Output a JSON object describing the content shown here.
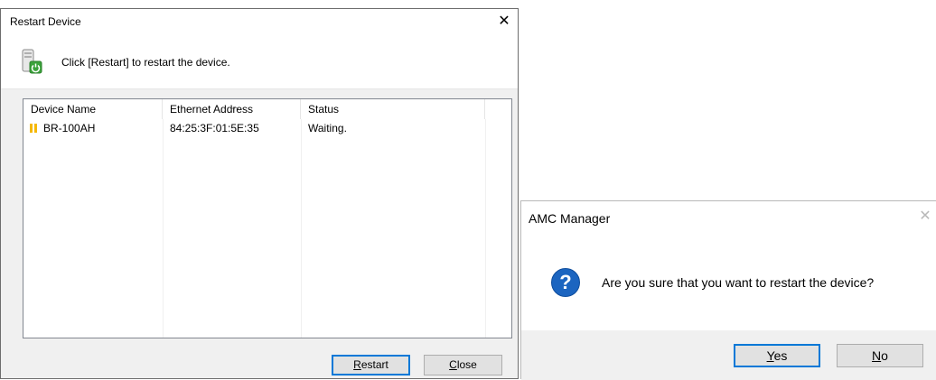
{
  "restart_dialog": {
    "title": "Restart Device",
    "close_glyph": "✕",
    "instruction": "Click [Restart] to restart the device.",
    "columns": [
      "Device Name",
      "Ethernet Address",
      "Status"
    ],
    "rows": [
      {
        "name": "BR-100AH",
        "ethernet": "84:25:3F:01:5E:35",
        "status": "Waiting."
      }
    ],
    "restart_button": {
      "label_first": "R",
      "label_rest": "estart"
    },
    "close_button": {
      "label_first": "C",
      "label_rest": "lose"
    }
  },
  "confirm_dialog": {
    "title": "AMC Manager",
    "close_glyph": "✕",
    "icon_glyph": "?",
    "message": "Are you sure that you want to restart the device?",
    "yes_button": {
      "label_first": "Y",
      "label_rest": "es"
    },
    "no_button": {
      "label_first": "N",
      "label_rest": "o"
    }
  },
  "colors": {
    "question_icon": "#1c65c0",
    "device_status_icon": "#f5b800",
    "default_button_border": "#0078d7"
  }
}
